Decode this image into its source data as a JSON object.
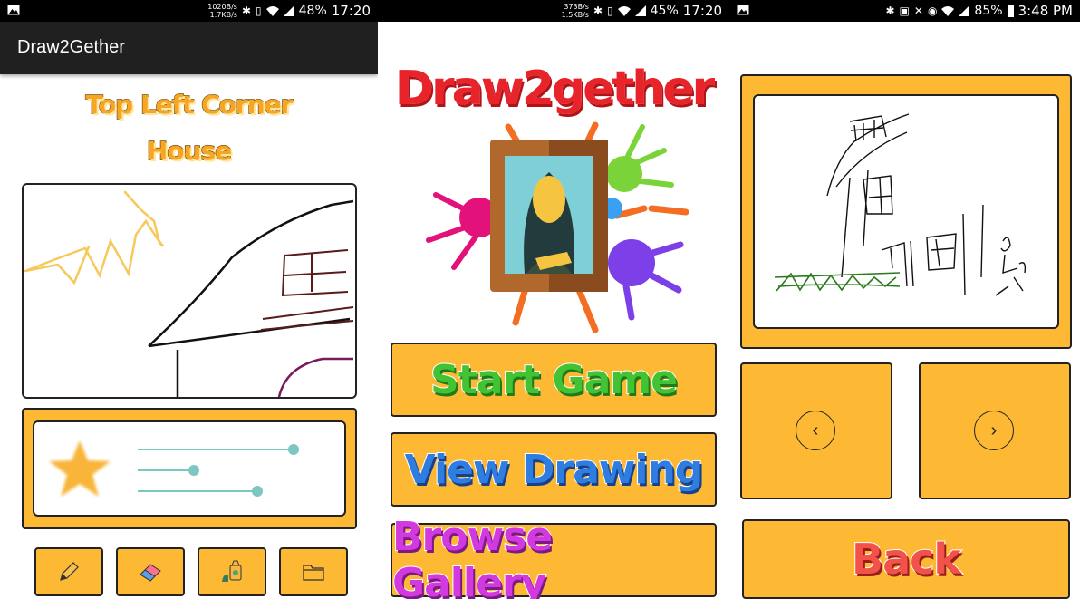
{
  "colors": {
    "panel_yellow": "#fdb934",
    "app_bar": "#202020",
    "status_bar": "#000000",
    "slider": "#7ec6c0"
  },
  "screen_draw": {
    "status": {
      "net_up": "1020B/s",
      "net_down": "1.7KB/s",
      "battery": "48%",
      "time": "17:20"
    },
    "app_title": "Draw2Gether",
    "prompt_line1": "Top Left Corner",
    "prompt_line2": "House",
    "brush_panel": {
      "icon": "star-icon",
      "slider_levels": [
        0.9,
        0.35,
        0.75
      ]
    },
    "tools": [
      {
        "name": "pencil-tool-button",
        "icon": "pencil-icon"
      },
      {
        "name": "eraser-tool-button",
        "icon": "eraser-icon"
      },
      {
        "name": "paint-bucket-tool-button",
        "icon": "paint-bucket-icon"
      },
      {
        "name": "folder-tool-button",
        "icon": "folder-icon"
      }
    ]
  },
  "screen_menu": {
    "status": {
      "net_up": "373B/s",
      "net_down": "1.5KB/s",
      "battery": "45%",
      "time": "17:20"
    },
    "logo_text": "Draw2gether",
    "buttons": {
      "start": "Start Game",
      "view": "View Drawing",
      "browse": "Browse Gallery"
    }
  },
  "screen_view": {
    "status": {
      "battery": "85%",
      "time": "3:48 PM"
    },
    "prev_icon": "‹",
    "next_icon": "›",
    "back_label": "Back"
  }
}
